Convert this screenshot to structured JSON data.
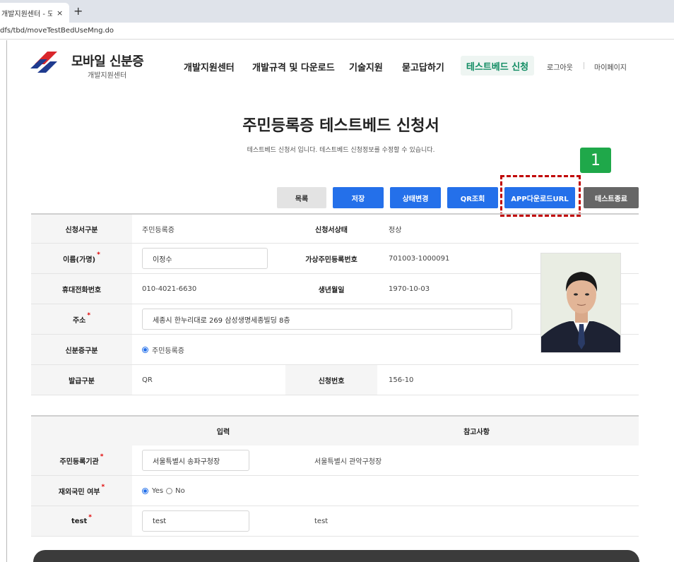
{
  "browser": {
    "tab_title": "개발지원센터 - 모",
    "tab_close": "×",
    "new_tab": "+",
    "url": "dfs/tbd/moveTestBedUseMng.do"
  },
  "site": {
    "brand_title": "모바일 신분증",
    "brand_sub": "개발지원센터",
    "nav": [
      "개발지원센터",
      "개발규격 및 다운로드",
      "기술지원",
      "묻고답하기"
    ],
    "nav_active": "테스트베드 신청",
    "logout": "로그아웃",
    "mypage": "마이페이지"
  },
  "heading": {
    "title": "주민등록증 테스트베드 신청서",
    "desc": "테스트베드 신청서 입니다. 테스트베드 신청정보를 수정할 수 있습니다."
  },
  "actions": {
    "list": "목록",
    "save": "저장",
    "status_change": "상태변경",
    "qr_lookup": "QR조회",
    "app_download_url": "APP다운로드URL",
    "test_end": "테스트종료"
  },
  "annotation": {
    "step_number": "1"
  },
  "form": {
    "type_label": "신청서구분",
    "type_value": "주민등록증",
    "status_label": "신청서상태",
    "status_value": "정상",
    "name_label": "이름(가명)",
    "name_value": "이정수",
    "virtual_id_label": "가상주민등록번호",
    "virtual_id_value": "701003-1000091",
    "phone_label": "휴대전화번호",
    "phone_value": "010-4021-6630",
    "birth_label": "생년월일",
    "birth_value": "1970-10-03",
    "address_label": "주소",
    "address_value": "세종시 한누리대로 269 삼성생명세종빌딩 8층",
    "id_type_label": "신분증구분",
    "id_type_value": "주민등록증",
    "issue_label": "발급구분",
    "issue_value": "QR",
    "apply_no_label": "신청번호",
    "apply_no_value": "156-10",
    "required_mark": "*"
  },
  "table2": {
    "col_input": "입력",
    "col_ref": "참고사항",
    "rows": [
      {
        "label": "주민등록기관",
        "input": "서울특별시 송파구청장",
        "ref": "서울특별시 관악구청장"
      },
      {
        "label": "재외국민 여부",
        "yes": "Yes",
        "no": "No",
        "ref": ""
      },
      {
        "label": "test",
        "input": "test",
        "ref": "test"
      }
    ]
  },
  "colors": {
    "primary_blue": "#2470ea",
    "active_green": "#0f8b61",
    "highlight_red": "#c00000",
    "badge_green": "#1fa84a"
  }
}
